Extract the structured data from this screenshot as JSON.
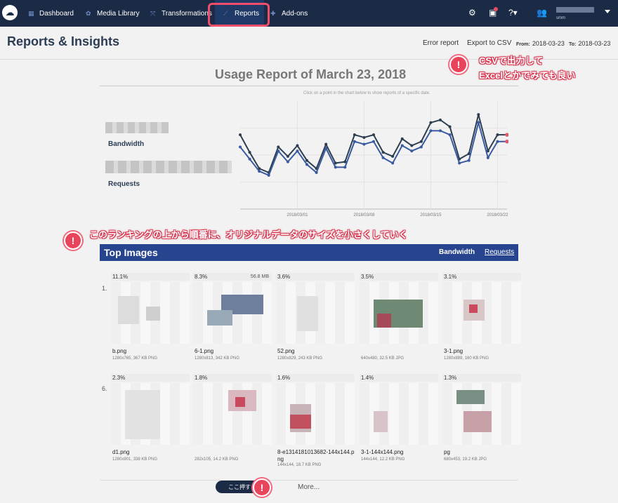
{
  "nav": {
    "items": [
      {
        "label": "Dashboard"
      },
      {
        "label": "Media Library"
      },
      {
        "label": "Transformations"
      },
      {
        "label": "Reports"
      },
      {
        "label": "Add-ons"
      }
    ],
    "user_sub": "smm"
  },
  "header": {
    "title": "Reports & Insights",
    "error_report": "Error report",
    "export_csv": "Export to CSV",
    "from_label": "From:",
    "from_value": "2018-03-23",
    "to_label": "To:",
    "to_value": "2018-03-23"
  },
  "callouts": {
    "csv_line1": "CSVで出力して",
    "csv_line2": "Excelとかでみても良い",
    "ranking": "このランキングの上から順番に、オリジナルデータのサイズを小さくしていく"
  },
  "usage": {
    "title": "Usage Report of March 23, 2018",
    "hint": "Click on a point in the chart below to show reports of a specific date.",
    "bandwidth_label": "Bandwidth",
    "requests_label": "Requests"
  },
  "chart_data": {
    "type": "line",
    "x": [
      "2018-02-23",
      "2018-02-24",
      "2018-02-25",
      "2018-02-26",
      "2018-02-27",
      "2018-02-28",
      "2018-03-01",
      "2018-03-02",
      "2018-03-03",
      "2018-03-04",
      "2018-03-05",
      "2018-03-06",
      "2018-03-07",
      "2018-03-08",
      "2018-03-09",
      "2018-03-10",
      "2018-03-11",
      "2018-03-12",
      "2018-03-13",
      "2018-03-14",
      "2018-03-15",
      "2018-03-16",
      "2018-03-17",
      "2018-03-18",
      "2018-03-19",
      "2018-03-20",
      "2018-03-21",
      "2018-03-22",
      "2018-03-23"
    ],
    "xticks": [
      "2018/03/01",
      "2018/03/08",
      "2018/03/15",
      "2018/03/22"
    ],
    "series": [
      {
        "values": [
          55,
          42,
          30,
          27,
          46,
          39,
          47,
          36,
          30,
          48,
          34,
          35,
          55,
          53,
          55,
          42,
          39,
          52,
          47,
          50,
          64,
          66,
          61,
          37,
          41,
          70,
          43,
          55,
          55
        ],
        "color": "#2c3e50"
      },
      {
        "values": [
          46,
          37,
          28,
          25,
          43,
          35,
          43,
          33,
          27,
          45,
          31,
          31,
          50,
          48,
          50,
          38,
          34,
          47,
          43,
          46,
          58,
          58,
          55,
          34,
          36,
          64,
          38,
          50,
          50
        ],
        "color": "#3a5aa0"
      }
    ],
    "ylim": [
      0,
      80
    ],
    "grid": true
  },
  "top_images": {
    "title": "Top Images",
    "bandwidth": "Bandwidth",
    "requests": "Requests",
    "row1_num": "1.",
    "row2_num": "6.",
    "cards": [
      {
        "pct": "11.1%",
        "size": "",
        "name": "b.png",
        "meta": "1280x765, 367 KB PNG"
      },
      {
        "pct": "8.3%",
        "size": "56.8 MB",
        "name": "6-1.png",
        "meta": "1280x813, 342 KB PNG"
      },
      {
        "pct": "3.6%",
        "size": "",
        "name": "52.png",
        "meta": "1280x829, 243 KB PNG"
      },
      {
        "pct": "3.5%",
        "size": "",
        "name": "",
        "meta": "640x480, 32.5 KB JPG"
      },
      {
        "pct": "3.1%",
        "size": "",
        "name": "3-1.png",
        "meta": "1280x889, 160 KB PNG"
      },
      {
        "pct": "2.3%",
        "size": "",
        "name": "d1.png",
        "meta": "1280x901, 338 KB PNG"
      },
      {
        "pct": "1.8%",
        "size": "",
        "name": "",
        "meta": "282x105, 14.2 KB PNG"
      },
      {
        "pct": "1.6%",
        "size": "",
        "name": "8-e1314181013682-144x144.png",
        "meta": "144x144, 18.7 KB PNG"
      },
      {
        "pct": "1.4%",
        "size": "",
        "name": "3-1-144x144.png",
        "meta": "144x144, 12.2 KB PNG"
      },
      {
        "pct": "1.3%",
        "size": "",
        "name": "pg",
        "meta": "680x453, 19.2 KB JPG"
      }
    ],
    "here_button": "ここ押す",
    "more": "More..."
  },
  "colors": {
    "nav_bg": "#1b2a45",
    "accent": "#27458f",
    "callout": "#e8445c"
  }
}
